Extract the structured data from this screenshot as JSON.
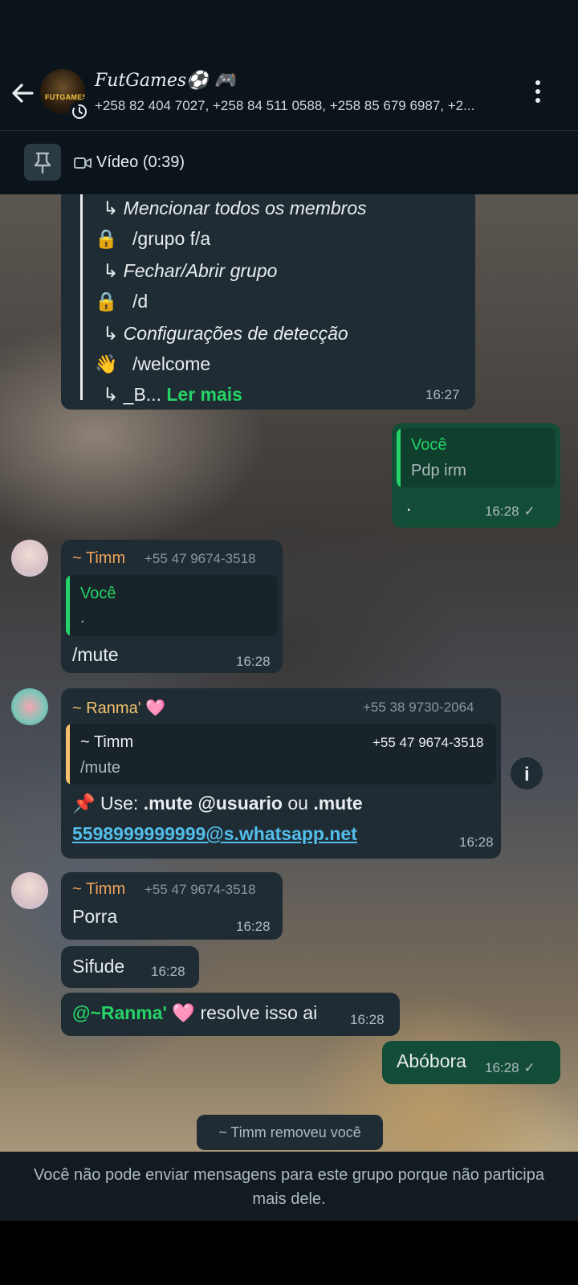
{
  "header": {
    "group_name": "FutGames⚽ 🎮",
    "avatar_text": "FUTGAMES",
    "participants": "+258 82 404 7027, +258 84 511 0588, +258 85 679 6987, +2..."
  },
  "pinned": {
    "label": "Vídeo (0:39)"
  },
  "bot_message": {
    "lines": [
      {
        "icon": "",
        "text": "↳ Mencionar todos os membros",
        "style": "sub"
      },
      {
        "icon": "🔒",
        "text": "/grupo f/a",
        "style": "cmd"
      },
      {
        "icon": "",
        "text": "↳ Fechar/Abrir grupo",
        "style": "sub"
      },
      {
        "icon": "🔒",
        "text": "/d",
        "style": "cmd"
      },
      {
        "icon": "",
        "text": "↳ Configurações de detecção",
        "style": "sub"
      },
      {
        "icon": "👋",
        "text": "/welcome",
        "style": "cmd"
      }
    ],
    "last_line": "↳ _B...",
    "read_more": "Ler mais",
    "time": "16:27"
  },
  "msg1": {
    "quote_name": "Você",
    "quote_text": "Pdp irm",
    "text": ".",
    "time": "16:28",
    "check": "✓"
  },
  "msg2": {
    "sender": "~ Timm",
    "phone": "+55 47 9674-3518",
    "quote_name": "Você",
    "quote_text": ".",
    "text": "/mute",
    "time": "16:28"
  },
  "msg3": {
    "sender": "~ Ranma' 🩷",
    "phone": "+55 38 9730-2064",
    "quote_name": "~ Timm",
    "quote_phone": "+55 47 9674-3518",
    "quote_text": "/mute",
    "text_prefix": "📌 Use: ",
    "cmd1": ".mute @usuario",
    "text_mid": " ou ",
    "cmd2": ".mute",
    "link": "5598999999999@s.whatsapp.net",
    "time": "16:28",
    "info": "i"
  },
  "msg4": {
    "sender": "~ Timm",
    "phone": "+55 47 9674-3518",
    "text": "Porra",
    "time": "16:28"
  },
  "msg5": {
    "text": "Sifude",
    "time": "16:28"
  },
  "msg6": {
    "mention": "@~Ranma' 🩷",
    "text": " resolve isso ai",
    "time": "16:28"
  },
  "msg7": {
    "text": "Abóbora",
    "time": "16:28",
    "check": "✓"
  },
  "system": {
    "text": "~ Timm removeu você"
  },
  "footer": {
    "text": "Você não pode enviar mensagens para este grupo porque não participa mais dele."
  },
  "colors": {
    "header_bg": "#0b141a",
    "bubble_in": "#1f2c34",
    "bubble_out": "#144d37",
    "accent_green": "#25d366",
    "timm_name": "#f0a25b",
    "ranma_name": "#f5c26b",
    "link": "#53bdeb"
  }
}
